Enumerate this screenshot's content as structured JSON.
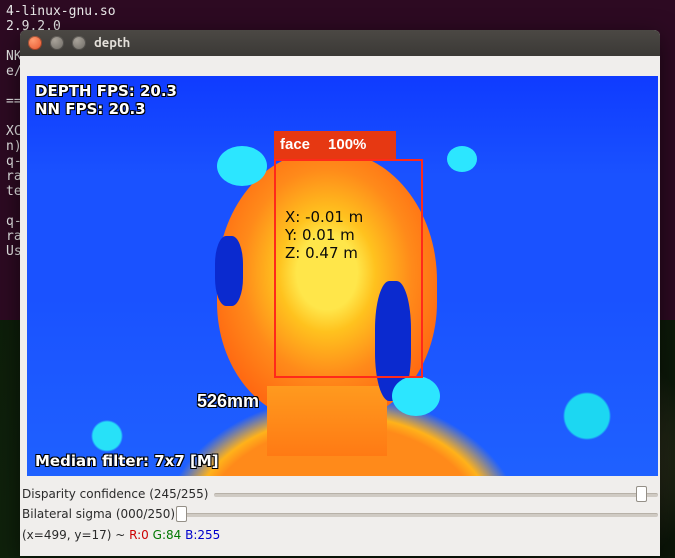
{
  "terminal": {
    "lines": [
      "4-linux-gnu.so",
      "2.9.2.0",
      " ",
      "NK_",
      "e/D",
      " ",
      "===",
      " ",
      "XCB",
      "n).",
      "q-b",
      "rac",
      "tec",
      " ",
      "q-b",
      "rac",
      "Use"
    ]
  },
  "window": {
    "title": "depth"
  },
  "overlay": {
    "fps_line1": "DEPTH FPS: 20.3",
    "fps_line2": "NN FPS: 20.3",
    "coords": "X: -0.01 m\nY: 0.01 m\nZ: 0.47 m",
    "distance_mm": "526mm",
    "filter": "Median filter: 7x7 [M]"
  },
  "detection": {
    "label": "face",
    "confidence": "100%"
  },
  "controls": {
    "disparity": {
      "label": "Disparity confidence (245/255)",
      "value": 245,
      "max": 255
    },
    "bilateral": {
      "label": "Bilateral sigma (000/250)",
      "value": 0,
      "max": 250
    }
  },
  "status": {
    "prefix": "(x=499, y=17) ~ ",
    "r": "R:0",
    "g": "G:84",
    "b": "B:255"
  }
}
